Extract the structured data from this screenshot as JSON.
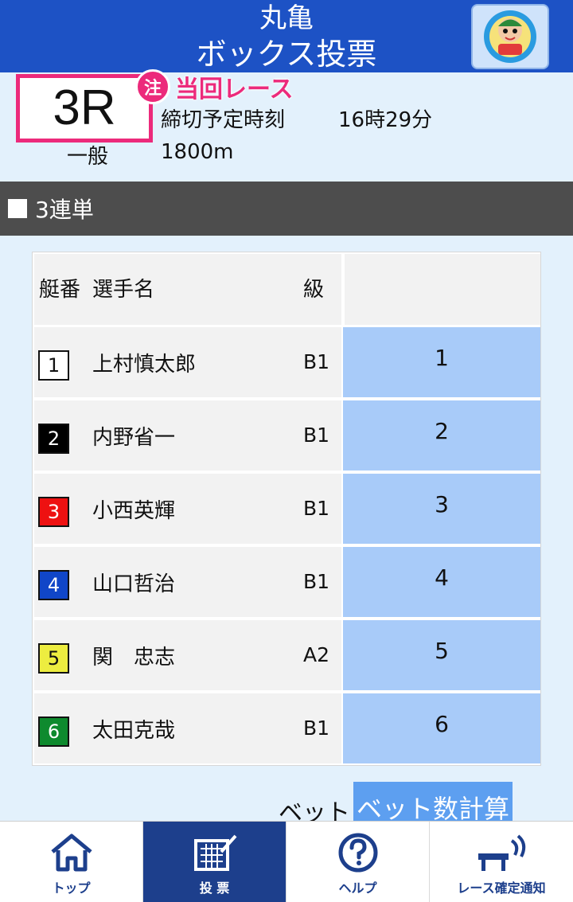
{
  "header": {
    "venue": "丸亀",
    "title": "ボックス投票",
    "mascot_icon": "mascot-icon"
  },
  "race": {
    "number": "3R",
    "notice_badge": "注",
    "notice_text": "当回レース",
    "deadline_label": "締切予定時刻",
    "deadline_time": "16時29分",
    "class": "一般",
    "distance": "1800m"
  },
  "section": {
    "title": "3連単"
  },
  "table": {
    "headers": {
      "boat": "艇番",
      "name": "選手名",
      "class": "級"
    },
    "rows": [
      {
        "boat": "1",
        "name": "上村慎太郎",
        "class": "B1",
        "select": "1",
        "color": "#ffffff",
        "text_color": "#111111"
      },
      {
        "boat": "2",
        "name": "内野省一",
        "class": "B1",
        "select": "2",
        "color": "#000000",
        "text_color": "#ffffff"
      },
      {
        "boat": "3",
        "name": "小西英輝",
        "class": "B1",
        "select": "3",
        "color": "#ee1111",
        "text_color": "#ffffff"
      },
      {
        "boat": "4",
        "name": "山口哲治",
        "class": "B1",
        "select": "4",
        "color": "#1046c8",
        "text_color": "#ffffff"
      },
      {
        "boat": "5",
        "name": "関　忠志",
        "class": "A2",
        "select": "5",
        "color": "#eded40",
        "text_color": "#111111"
      },
      {
        "boat": "6",
        "name": "太田克哉",
        "class": "B1",
        "select": "6",
        "color": "#0e8a2e",
        "text_color": "#ffffff"
      }
    ]
  },
  "bet": {
    "label": "ベット",
    "button": "ベット数計算"
  },
  "nav": {
    "items": [
      {
        "label": "トップ",
        "icon": "home-icon"
      },
      {
        "label": "投 票",
        "icon": "vote-icon",
        "active": true
      },
      {
        "label": "ヘルプ",
        "icon": "help-icon"
      },
      {
        "label": "レース確定通知",
        "icon": "notification-icon"
      }
    ]
  },
  "colors": {
    "header_bg": "#1d52c5",
    "accent_pink": "#ec2a7b",
    "select_cell": "#a8cbf9",
    "nav_active": "#1d3f8c"
  }
}
